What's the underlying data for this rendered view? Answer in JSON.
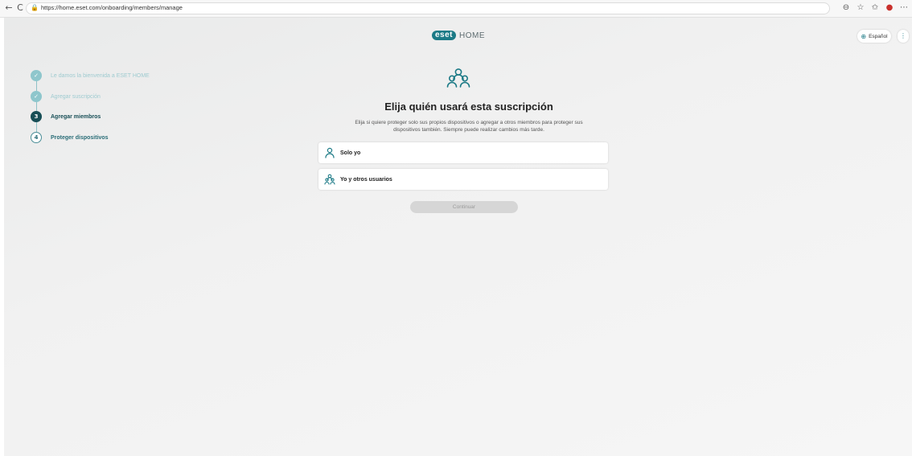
{
  "browser": {
    "url": "https://home.eset.com/onboarding/members/manage",
    "back_icon": "←",
    "reload_icon": "C",
    "lock_icon": "🔒"
  },
  "header": {
    "logo_badge": "eset",
    "logo_text": "HOME",
    "language_label": "Español",
    "more_icon": "⋮"
  },
  "steps": [
    {
      "number": "✓",
      "label": "Le damos la bienvenida a ESET HOME",
      "state": "done"
    },
    {
      "number": "✓",
      "label": "Agregar suscripción",
      "state": "done"
    },
    {
      "number": "3",
      "label": "Agregar miembros",
      "state": "active"
    },
    {
      "number": "4",
      "label": "Proteger dispositivos",
      "state": "todo"
    }
  ],
  "main": {
    "heading": "Elija quién usará esta suscripción",
    "subtitle_line1": "Elija si quiere proteger solo sus propios dispositivos o agregar a otros miembros para proteger sus",
    "subtitle_line2": "dispositivos también. Siempre puede realizar cambios más tarde.",
    "options": [
      {
        "label": "Solo yo",
        "icon": "person-icon"
      },
      {
        "label": "Yo y otros usuarios",
        "icon": "people-icon"
      }
    ],
    "continue_label": "Continuar"
  },
  "colors": {
    "accent": "#1c7a86",
    "step_active": "#174e56",
    "step_done": "#8ec6cc"
  }
}
